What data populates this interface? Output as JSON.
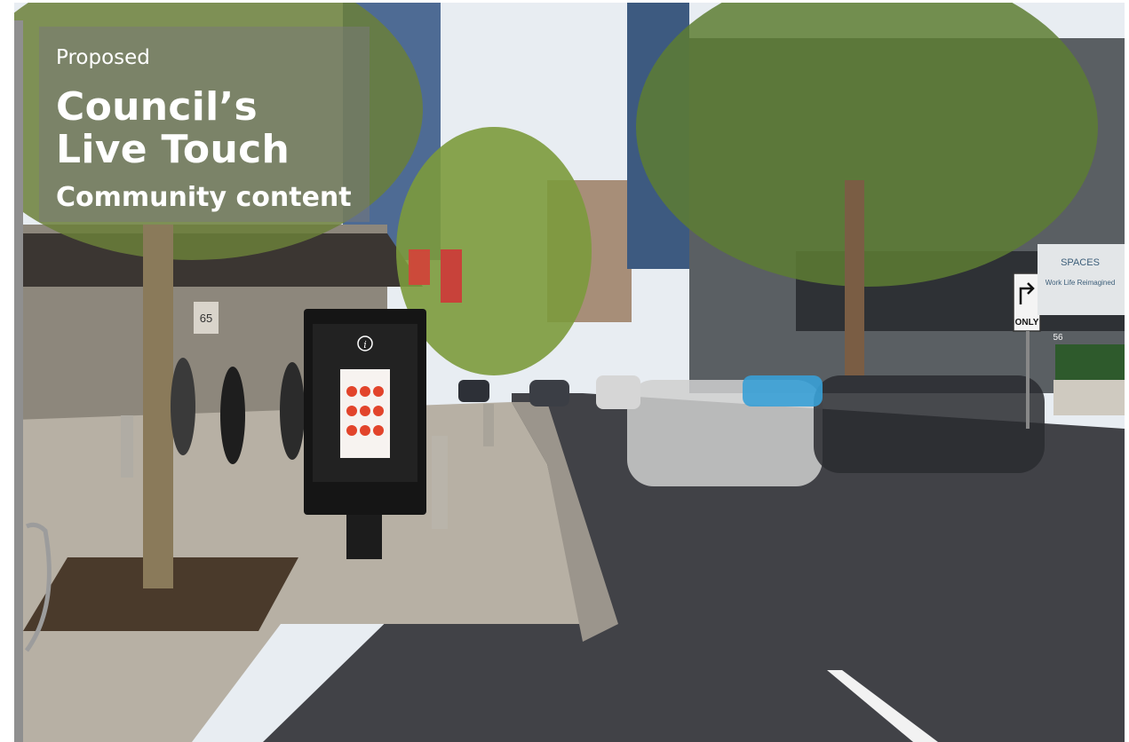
{
  "overlay": {
    "kicker": "Proposed",
    "title_line1": "Council’s",
    "title_line2": "Live Touch",
    "subtitle": "Community content"
  },
  "signs": {
    "building_number_left": "65",
    "building_number_right": "56",
    "turn_sign": "ONLY",
    "banner_brand": "SPACES",
    "banner_tagline": "Work Life Reimagined"
  },
  "kiosk": {
    "info_icon": "info-icon"
  },
  "colors": {
    "overlay_bg": "#787878",
    "sky": "#e9eef3",
    "road": "#3f3f44",
    "pavement": "#b8b2a8",
    "kiosk_body": "#151515",
    "kiosk_screen_accent": "#e2442b",
    "foliage": "#6f8a3a"
  }
}
